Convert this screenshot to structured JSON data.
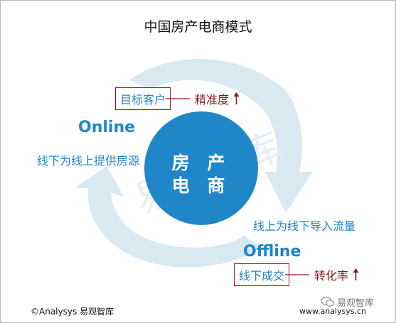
{
  "title": "中国房产电商模式",
  "center": {
    "line1": "房 产",
    "line2": "电 商"
  },
  "online": {
    "label": "Online",
    "flow": "线下为线上提供房源",
    "box": "目标客户",
    "metric": "精准度"
  },
  "offline": {
    "label": "Offline",
    "flow": "线上为线下导入流量",
    "box": "线下成交",
    "metric": "转化率"
  },
  "watermark": {
    "text": "易观智库",
    "handle": "易观智库"
  },
  "footer": {
    "copyright": "©Analysys 易观智库",
    "url": "www.analysys.cn"
  },
  "colors": {
    "accent": "#1f86c7",
    "cycle": "#d8e9f2",
    "metric": "#8c1a1a"
  },
  "icons": {
    "up_arrow": "arrow-up-icon",
    "wechat": "wechat-icon"
  }
}
